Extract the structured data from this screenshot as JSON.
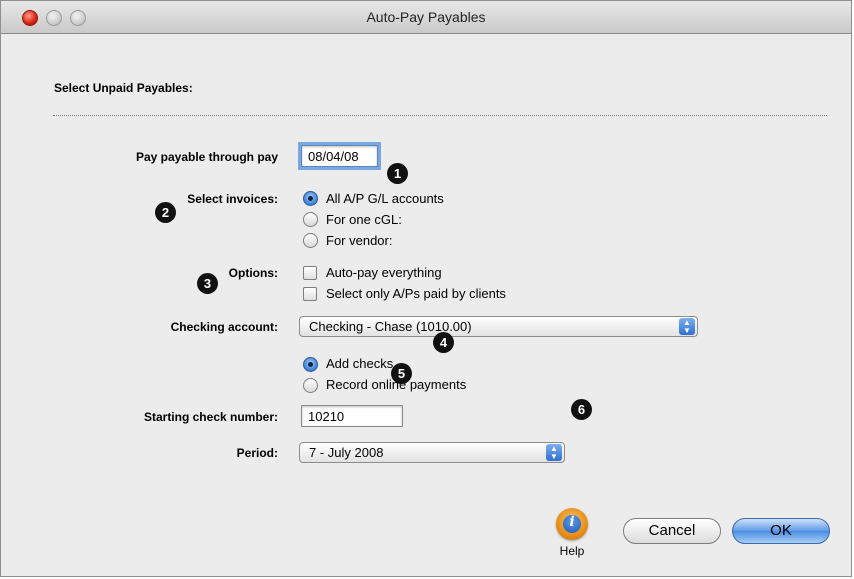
{
  "window": {
    "title": "Auto-Pay Payables"
  },
  "section": {
    "heading": "Select Unpaid Payables:"
  },
  "pay_through": {
    "label": "Pay payable through pay",
    "value": "08/04/08"
  },
  "select_invoices": {
    "label": "Select invoices:",
    "options": [
      "All A/P G/L accounts",
      "For one cGL:",
      "For vendor:"
    ],
    "selected": "All A/P G/L accounts"
  },
  "options_group": {
    "label": "Options:",
    "checkboxes": [
      "Auto-pay everything",
      "Select only A/Ps paid by clients"
    ]
  },
  "checking_account": {
    "label": "Checking account:",
    "value": "Checking - Chase (1010.00)"
  },
  "payment_mode": {
    "options": [
      "Add checks",
      "Record online payments"
    ],
    "selected": "Add checks"
  },
  "starting_check": {
    "label": "Starting check number:",
    "value": "10210"
  },
  "period": {
    "label": "Period:",
    "value": "7 - July 2008"
  },
  "callouts": [
    "1",
    "2",
    "3",
    "4",
    "5",
    "6"
  ],
  "buttons": {
    "help": "Help",
    "cancel": "Cancel",
    "ok": "OK"
  },
  "colors": {
    "ok_accent": "#4a8de4",
    "help_icon": "#e48a12",
    "window_bg": "#ececec"
  }
}
